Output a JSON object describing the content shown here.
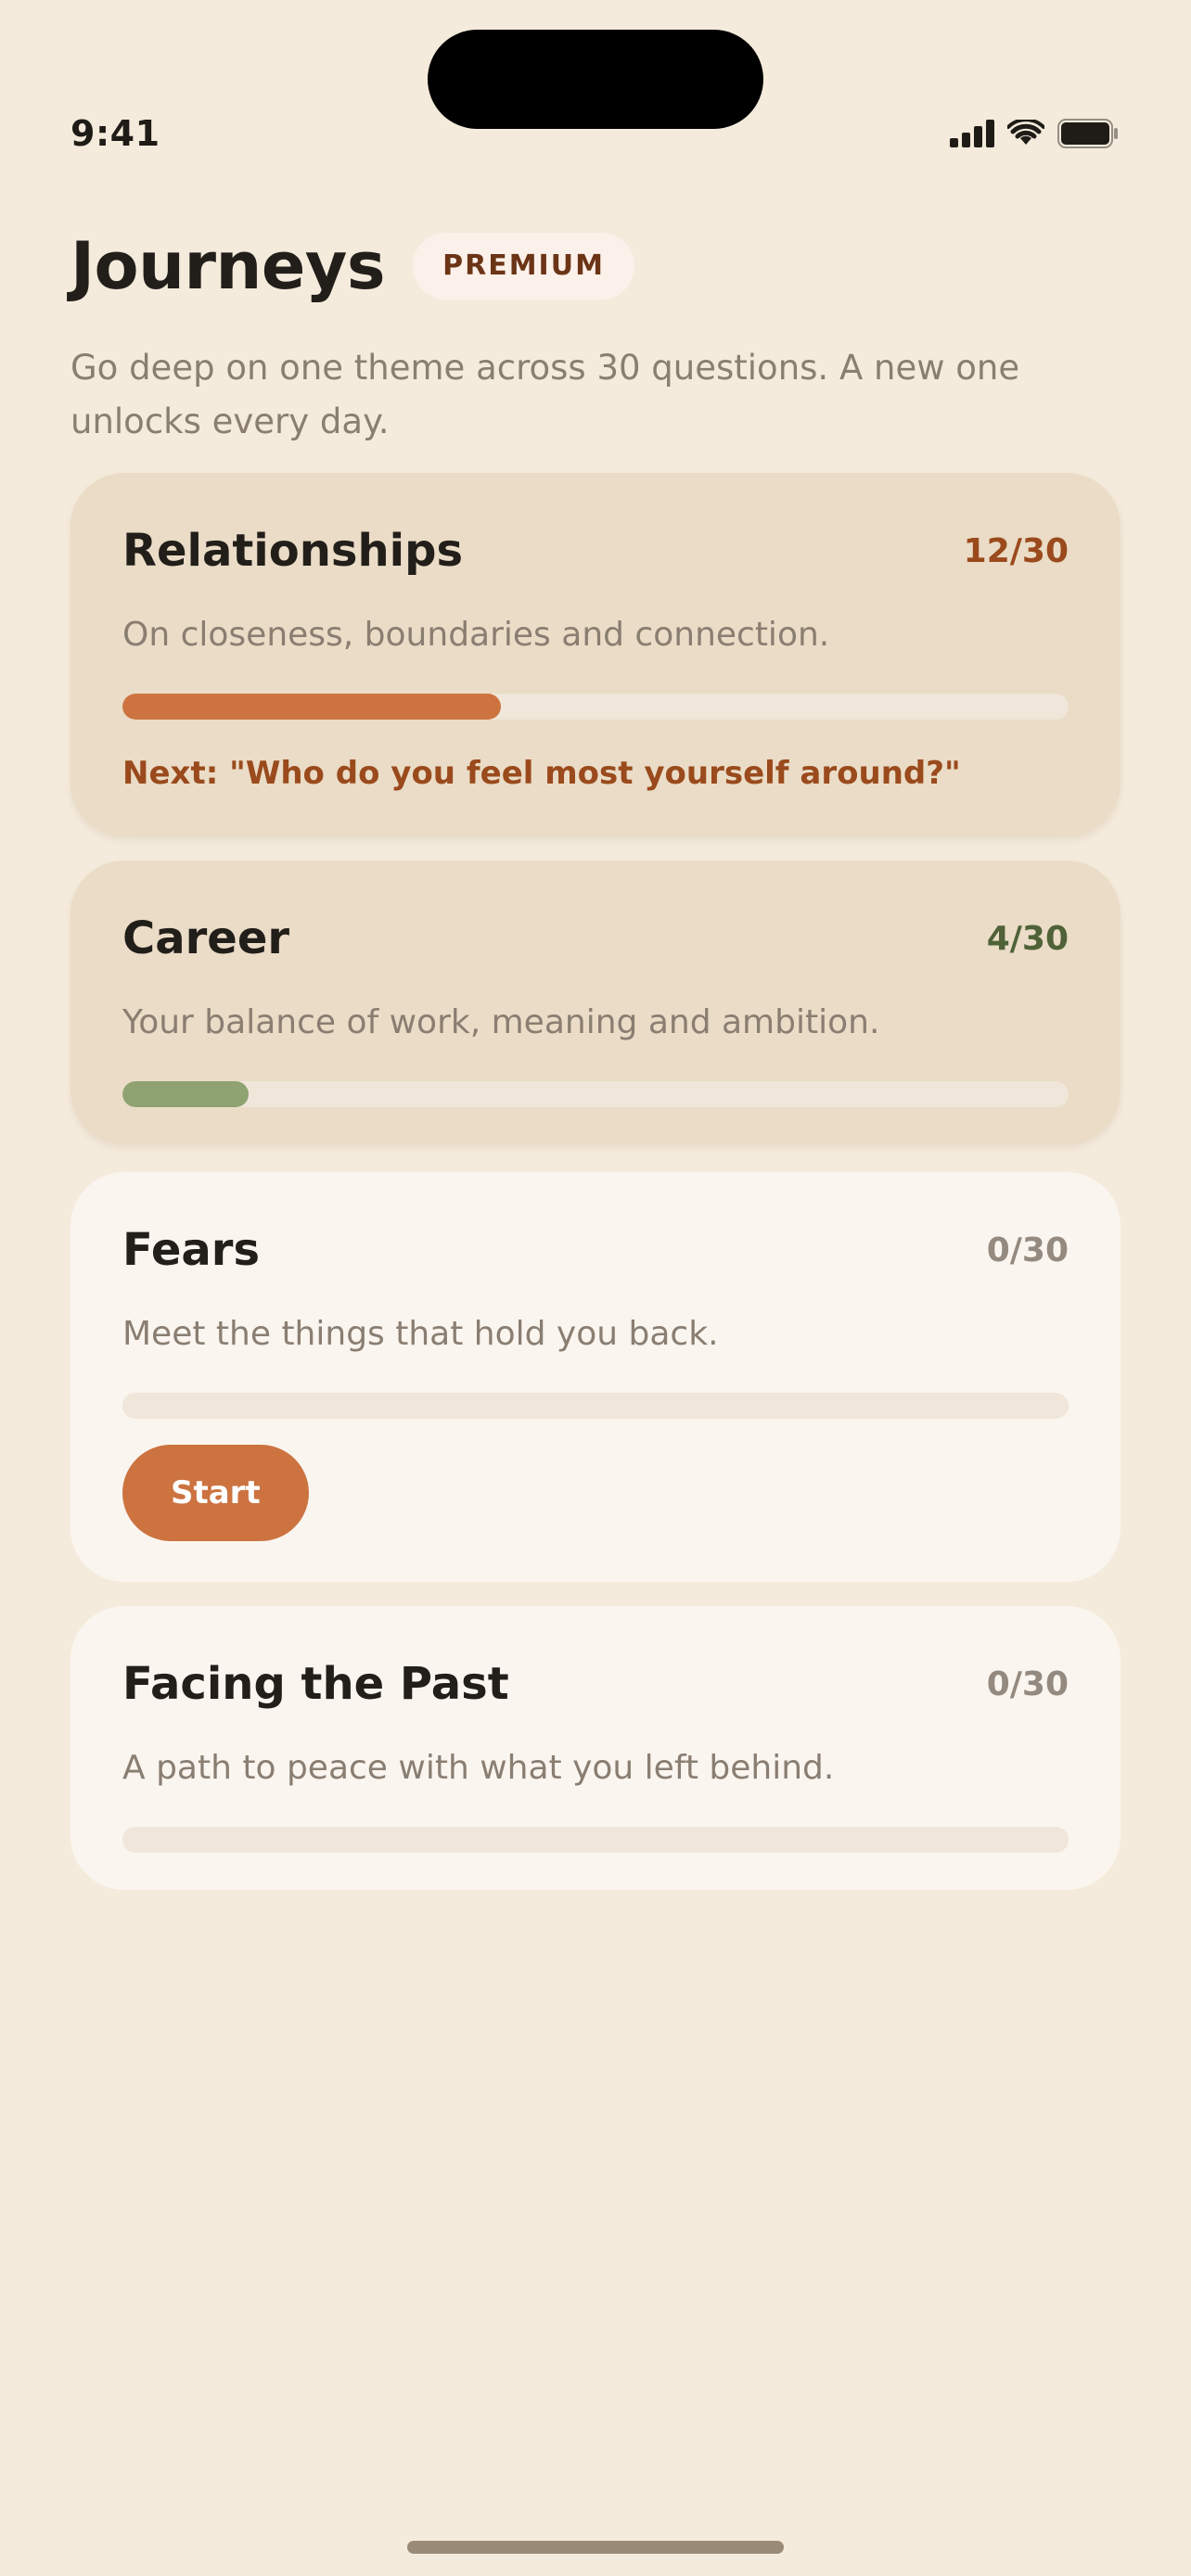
{
  "status_bar": {
    "time": "9:41",
    "icons": [
      "cellular-signal-icon",
      "wifi-icon",
      "battery-icon"
    ]
  },
  "header": {
    "title": "Journeys",
    "badge": "PREMIUM",
    "subtitle": "Go deep on one theme across 30 questions. A new one unlocks every day."
  },
  "colors": {
    "background": "#F5EBDC",
    "accent_orange": "#CC7340",
    "accent_rust_text": "#9A4A1C",
    "accent_green": "#8FA272",
    "green_text": "#4F6238",
    "muted_text": "#8A7E72"
  },
  "journeys": [
    {
      "title": "Relationships",
      "count": "12/30",
      "description": "On closeness, boundaries and connection.",
      "progress": 0.4,
      "next": "Next: \"Who do you feel most yourself around?\""
    },
    {
      "title": "Career",
      "count": "4/30",
      "description": "Your balance of work, meaning and ambition.",
      "progress": 0.1333
    },
    {
      "title": "Fears",
      "count": "0/30",
      "description": "Meet the things that hold you back.",
      "progress": 0,
      "start_label": "Start"
    },
    {
      "title": "Facing the Past",
      "count": "0/30",
      "description": "A path to peace with what you left behind.",
      "progress": 0
    }
  ]
}
